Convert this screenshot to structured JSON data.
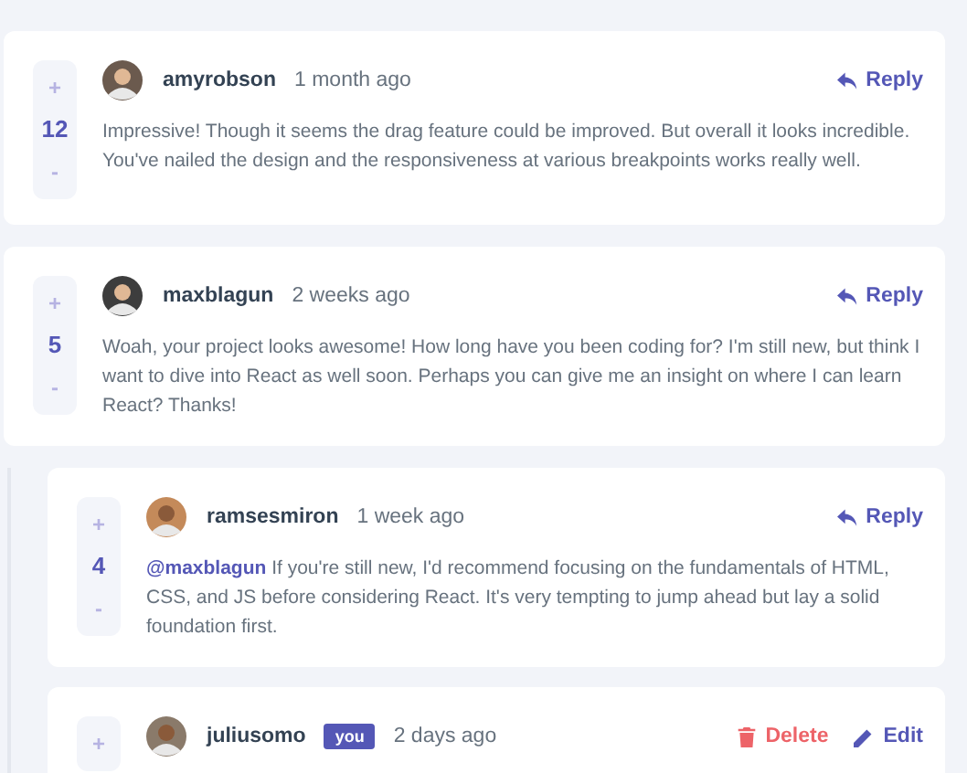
{
  "comments": [
    {
      "user": "amyrobson",
      "time": "1 month ago",
      "upvote": "+",
      "score": "12",
      "downvote": "-",
      "text": "Impressive! Though it seems the drag feature could be improved. But overall it looks incredible. You've nailed the design and the responsiveness at various breakpoints works really well.",
      "actions": [
        {
          "kind": "reply",
          "label": "Reply"
        }
      ]
    },
    {
      "user": "maxblagun",
      "time": "2 weeks ago",
      "upvote": "+",
      "score": "5",
      "downvote": "-",
      "text": "Woah, your project looks awesome! How long have you been coding for? I'm still new, but think I want to dive into React as well soon. Perhaps you can give me an insight on where I can learn React? Thanks!",
      "actions": [
        {
          "kind": "reply",
          "label": "Reply"
        }
      ],
      "children": [
        {
          "user": "ramsesmiron",
          "time": "1 week ago",
          "upvote": "+",
          "score": "4",
          "downvote": "-",
          "text": "**@maxblagun** If you're still new, I'd recommend focusing on the fundamentals of HTML, CSS, and JS before considering React. It's very tempting to jump ahead but lay a solid foundation first.",
          "actions": [
            {
              "kind": "reply",
              "label": "Reply"
            }
          ]
        },
        {
          "user": "juliusomo",
          "badge": "you",
          "time": "2 days ago",
          "upvote": "+",
          "actions": [
            {
              "kind": "delete",
              "label": "Delete"
            },
            {
              "kind": "edit",
              "label": "Edit"
            }
          ]
        }
      ]
    }
  ]
}
